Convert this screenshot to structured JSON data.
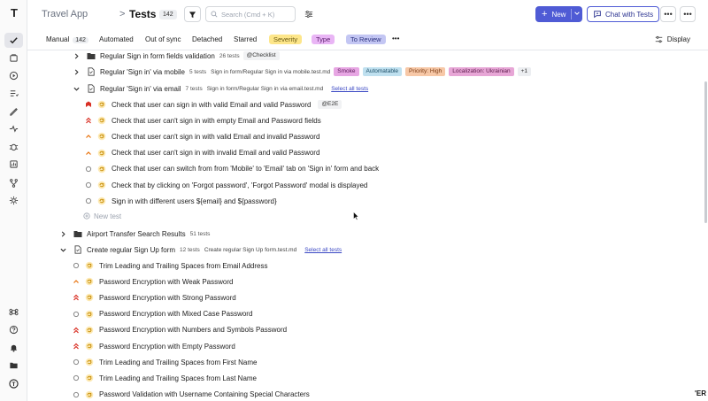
{
  "app": {
    "name": "Travel App",
    "separator": ">",
    "section": "Tests",
    "count": "142"
  },
  "search": {
    "placeholder": "Search (Cmd + K)"
  },
  "buttons": {
    "new": "New",
    "chat": "Chat with Tests",
    "more": "•••"
  },
  "tabs": [
    {
      "label": "Manual",
      "count": "142"
    },
    {
      "label": "Automated"
    },
    {
      "label": "Out of sync"
    },
    {
      "label": "Detached"
    },
    {
      "label": "Starred"
    }
  ],
  "chips": [
    {
      "label": "Severity",
      "bg": "#fde68a",
      "color": "#6b5a12"
    },
    {
      "label": "Type",
      "bg": "#e9b5f5",
      "color": "#5b1f6e"
    },
    {
      "label": "To Review",
      "bg": "#c3c6f3",
      "color": "#2e3480"
    }
  ],
  "tabs_more": "•••",
  "display": "Display",
  "tree": {
    "suite1": {
      "label": "Regular Sign in form fields validation",
      "meta": "26 tests",
      "tag": "@Checklist"
    },
    "suite2": {
      "label": "Regular 'Sign in' via mobile",
      "meta": "5 tests",
      "path": "Sign in form/Regular Sign in via mobile.test.md",
      "tags": [
        {
          "label": "Smoke",
          "bg": "#e7a6e3",
          "color": "#5b1a5a"
        },
        {
          "label": "Automatable",
          "bg": "#bfe0ef",
          "color": "#1c4d66"
        },
        {
          "label": "Priority: High",
          "bg": "#f7c8a7",
          "color": "#7a3a12"
        },
        {
          "label": "Localization: Ukrainian",
          "bg": "#e7a6d6",
          "color": "#5b1a4a"
        },
        {
          "label": "+1",
          "bg": "#eceef1",
          "color": "#333"
        }
      ]
    },
    "suite3": {
      "label": "Regular 'Sign in' via email",
      "meta": "7 tests",
      "path": "Sign in form/Regular Sign in via email.test.md",
      "link": "Select all tests"
    },
    "suite3_tests": [
      {
        "label": "Check that user can sign in with valid Email and valid Password",
        "tag": "@E2E",
        "prio": "critical"
      },
      {
        "label": "Check that user can't sign in with empty Email and Password fields",
        "prio": "high"
      },
      {
        "label": "Check that user can't sign in with valid Email and invalid Password",
        "prio": "medium"
      },
      {
        "label": "Check that user can't sign in with invalid Email and valid Password",
        "prio": "medium"
      },
      {
        "label": "Check that user can switch from from 'Mobile' to 'Email' tab on 'Sign in' form and back",
        "prio": "none"
      },
      {
        "label": "Check that by clicking on 'Forgot password', 'Forgot Password' modal is displayed",
        "prio": "none"
      },
      {
        "label": "Sign in with different users ${email} and ${password}",
        "prio": "none"
      }
    ],
    "new_test": "New test",
    "suite4": {
      "label": "Airport Transfer Search Results",
      "meta": "51 tests"
    },
    "suite5": {
      "label": "Create regular Sign Up form",
      "meta": "12 tests",
      "path": "Create regular Sign Up form.test.md",
      "link": "Select all tests"
    },
    "suite5_tests": [
      {
        "label": "Trim Leading and Trailing Spaces from Email Address",
        "prio": "none"
      },
      {
        "label": "Password Encryption with Weak Password",
        "prio": "medium"
      },
      {
        "label": "Password Encryption with Strong Password",
        "prio": "high"
      },
      {
        "label": "Password Encryption with Mixed Case Password",
        "prio": "none"
      },
      {
        "label": "Password Encryption with Numbers and Symbols Password",
        "prio": "high"
      },
      {
        "label": "Password Encryption with Empty Password",
        "prio": "high"
      },
      {
        "label": "Trim Leading and Trailing Spaces from First Name",
        "prio": "none"
      },
      {
        "label": "Trim Leading and Trailing Spaces from Last Name",
        "prio": "none"
      },
      {
        "label": "Password Validation with Username Containing Special Characters",
        "prio": "none"
      }
    ]
  },
  "corner_text": "'ER"
}
